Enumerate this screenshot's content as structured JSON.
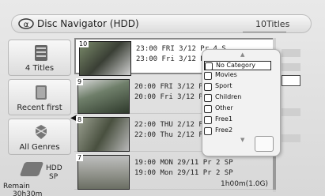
{
  "header": {
    "title": "Disc Navigator (HDD)",
    "title_count": "10Titles"
  },
  "left_panel": {
    "buttons": [
      {
        "label": "4 Titles",
        "icon": "titles-icon"
      },
      {
        "label": "Recent first",
        "icon": "recent-icon"
      },
      {
        "label": "All Genres",
        "icon": "genre-icon"
      }
    ]
  },
  "remain": {
    "drive": "HDD",
    "mode": "SP",
    "label": "Remain",
    "time": "30h30m"
  },
  "rows": [
    {
      "number": "10",
      "line1": "23:00 FRI 3/12 Pr 4 S",
      "line2": "23:00 Fri 3/12 Pr"
    },
    {
      "number": "9",
      "line1": "20:00 FRI 3/12 P",
      "line2": "20:00  Fri 3/12 P"
    },
    {
      "number": "8",
      "line1": "22:00 THU 2/12 F",
      "line2": "22:00  Thu 2/12 F"
    },
    {
      "number": "7",
      "line1": "19:00 MON 29/11 Pr 2 SP",
      "line2": "19:00 Mon 29/11 Pr 2 SP",
      "size": "1h00m(1.0G)"
    }
  ],
  "popup": {
    "categories": [
      {
        "label": "No Category",
        "icon": "none-icon"
      },
      {
        "label": "Movies",
        "icon": "movie-icon"
      },
      {
        "label": "Sport",
        "icon": "sport-icon"
      },
      {
        "label": "Children",
        "icon": "children-icon"
      },
      {
        "label": "Other",
        "icon": "other-icon"
      },
      {
        "label": "Free1",
        "icon": "free1-icon"
      },
      {
        "label": "Free2",
        "icon": "free2-icon"
      }
    ]
  }
}
